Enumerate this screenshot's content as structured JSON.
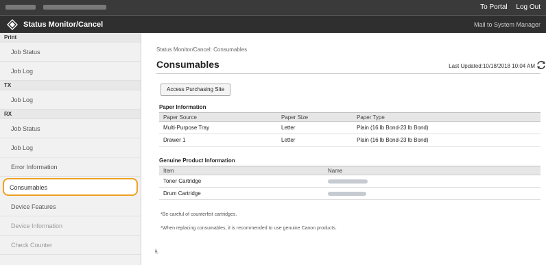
{
  "topbar": {
    "links": [
      {
        "label": "To Portal"
      },
      {
        "label": "Log Out"
      }
    ]
  },
  "titlebar": {
    "title": "Status Monitor/Cancel",
    "mail": "Mail to System Manager"
  },
  "sidebar": {
    "print_header": "Print",
    "print_items": [
      "Job Status",
      "Job Log"
    ],
    "tx_header": "TX",
    "tx_items": [
      "Job Log"
    ],
    "rx_header": "RX",
    "rx_items": [
      "Job Status",
      "Job Log"
    ],
    "extra_items": [
      "Error Information",
      "Consumables",
      "Device Features",
      "Device Information",
      "Check Counter"
    ],
    "active": "Consumables"
  },
  "main": {
    "breadcrumb": "Status Monitor/Cancel: Consumables",
    "heading": "Consumables",
    "last_updated": "Last Updated:10/18/2018 10:04 AM",
    "purchase_button": "Access Purchasing Site",
    "paper": {
      "title": "Paper Information",
      "headers": [
        "Paper Source",
        "Paper Size",
        "Paper Type"
      ],
      "rows": [
        [
          "Multi-Purpose Tray",
          "Letter",
          "Plain (16 lb Bond-23 lb Bond)"
        ],
        [
          "Drawer 1",
          "Letter",
          "Plain (16 lb Bond-23 lb Bond)"
        ]
      ]
    },
    "genuine": {
      "title": "Genuine Product Information",
      "headers": [
        "Item",
        "Name"
      ],
      "rows": [
        [
          "Toner Cartridge"
        ],
        [
          "Drum Cartridge"
        ]
      ]
    },
    "note1": "*Be careful of counterfeit cartridges.",
    "note2": "*When replacing consumables, it is recommended to use genuine Canon products.",
    "top_link": "Ⱡ"
  },
  "colors": {
    "topbar": "#3a3a3a",
    "titlebar": "#2f2f2f",
    "active_outline": "#f0a020"
  },
  "icons": {
    "logo": "canon-logo-icon",
    "refresh": "refresh-icon"
  }
}
